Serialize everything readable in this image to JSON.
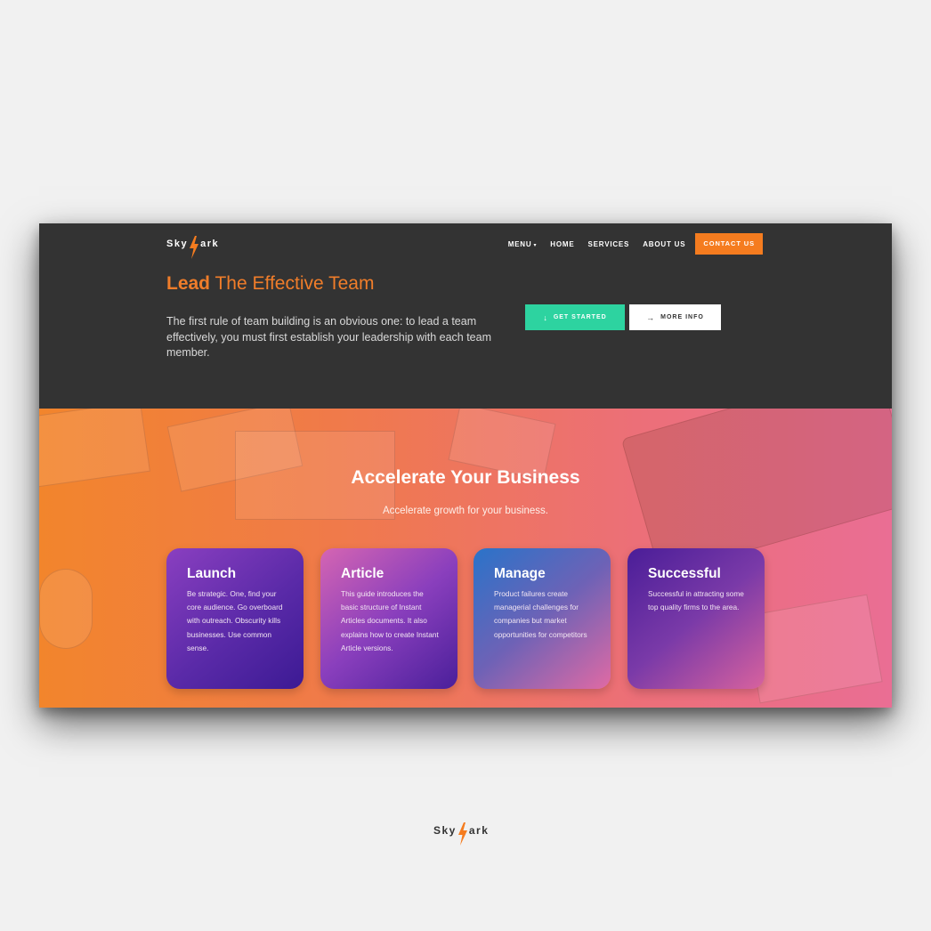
{
  "brand": {
    "name_start": "Sky",
    "name_end": "ark"
  },
  "colors": {
    "accent": "#f57c1f",
    "hero_bg": "#333333",
    "start_btn": "#2dd3a0"
  },
  "nav": {
    "items": [
      {
        "label": "MENU",
        "dropdown": true
      },
      {
        "label": "HOME"
      },
      {
        "label": "SERVICES"
      },
      {
        "label": "ABOUT US"
      }
    ],
    "contact": "CONTACT US"
  },
  "hero": {
    "headline_bold": "Lead",
    "headline_rest": "The Effective Team",
    "description": "The first rule of team building is an obvious one: to lead a team effectively, you must first establish your leadership with each team member.",
    "get_started": "GET STARTED",
    "get_started_icon": "arrow-down-icon",
    "more_info": "MORE INFO",
    "more_info_icon": "arrow-right-icon"
  },
  "section": {
    "title": "Accelerate Your Business",
    "subtitle": "Accelerate growth for your business."
  },
  "cards": [
    {
      "title": "Launch",
      "text": "Be strategic. One, find your core audience. Go overboard with outreach. Obscurity kills businesses.  Use common sense."
    },
    {
      "title": "Article",
      "text": "This guide introduces the basic structure of Instant Articles documents. It also explains how to create Instant Article versions."
    },
    {
      "title": "Manage",
      "text": "Product failures create managerial challenges for companies but market opportunities for competitors"
    },
    {
      "title": "Successful",
      "text": "Successful in attracting some top quality firms to the area."
    }
  ]
}
